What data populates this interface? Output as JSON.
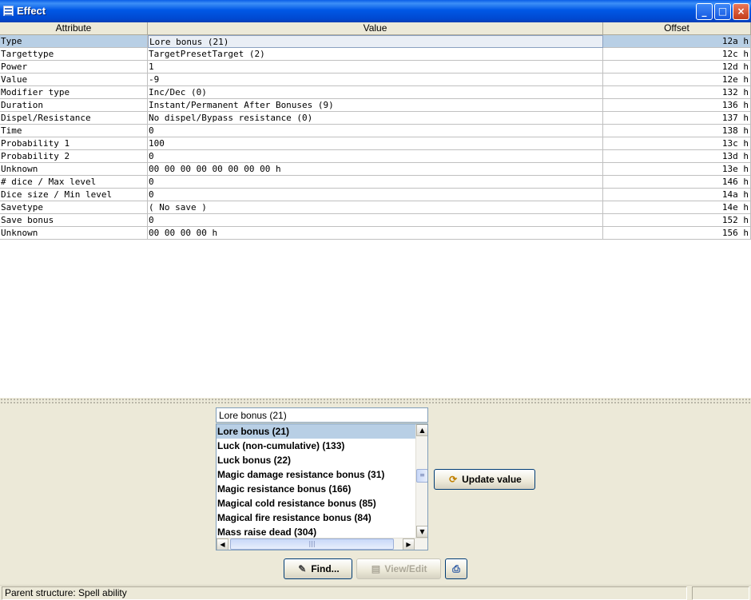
{
  "window": {
    "title": "Effect",
    "controls": {
      "minimize": "_",
      "maximize": "□",
      "close": "×"
    }
  },
  "table": {
    "columns": [
      "Attribute",
      "Value",
      "Offset"
    ],
    "rows": [
      {
        "attribute": "Type",
        "value": "Lore bonus (21)",
        "offset": "12a h"
      },
      {
        "attribute": "Targettype",
        "value": "TargetPresetTarget (2)",
        "offset": "12c h"
      },
      {
        "attribute": "Power",
        "value": "1",
        "offset": "12d h"
      },
      {
        "attribute": "Value",
        "value": "-9",
        "offset": "12e h"
      },
      {
        "attribute": "Modifier type",
        "value": "Inc/Dec (0)",
        "offset": "132 h"
      },
      {
        "attribute": "Duration",
        "value": "Instant/Permanent After Bonuses (9)",
        "offset": "136 h"
      },
      {
        "attribute": "Dispel/Resistance",
        "value": "No dispel/Bypass resistance (0)",
        "offset": "137 h"
      },
      {
        "attribute": "Time",
        "value": "0",
        "offset": "138 h"
      },
      {
        "attribute": "Probability 1",
        "value": "100",
        "offset": "13c h"
      },
      {
        "attribute": "Probability 2",
        "value": "0",
        "offset": "13d h"
      },
      {
        "attribute": "Unknown",
        "value": "00 00 00 00 00 00 00 00 h",
        "offset": "13e h"
      },
      {
        "attribute": "# dice / Max level",
        "value": "0",
        "offset": "146 h"
      },
      {
        "attribute": "Dice size / Min level",
        "value": "0",
        "offset": "14a h"
      },
      {
        "attribute": "Savetype",
        "value": "( No save )",
        "offset": "14e h"
      },
      {
        "attribute": "Save bonus",
        "value": "0",
        "offset": "152 h"
      },
      {
        "attribute": "Unknown",
        "value": "00 00 00 00 h",
        "offset": "156 h"
      }
    ],
    "selected_row": 0
  },
  "editor": {
    "input_value": "Lore bonus (21)",
    "list_items": [
      "Lore bonus (21)",
      "Luck (non-cumulative) (133)",
      "Luck bonus (22)",
      "Magic damage resistance bonus (31)",
      "Magic resistance bonus (166)",
      "Magical cold resistance bonus (85)",
      "Magical fire resistance bonus (84)",
      "Mass raise dead (304)"
    ],
    "selected_item": 0,
    "update_label": "Update value"
  },
  "buttons": {
    "find_label": "Find...",
    "view_edit_label": "View/Edit"
  },
  "status": {
    "text": "Parent structure: Spell ability"
  },
  "colors": {
    "selection": "#b8cfe5",
    "titlebar": "#0058e6"
  }
}
